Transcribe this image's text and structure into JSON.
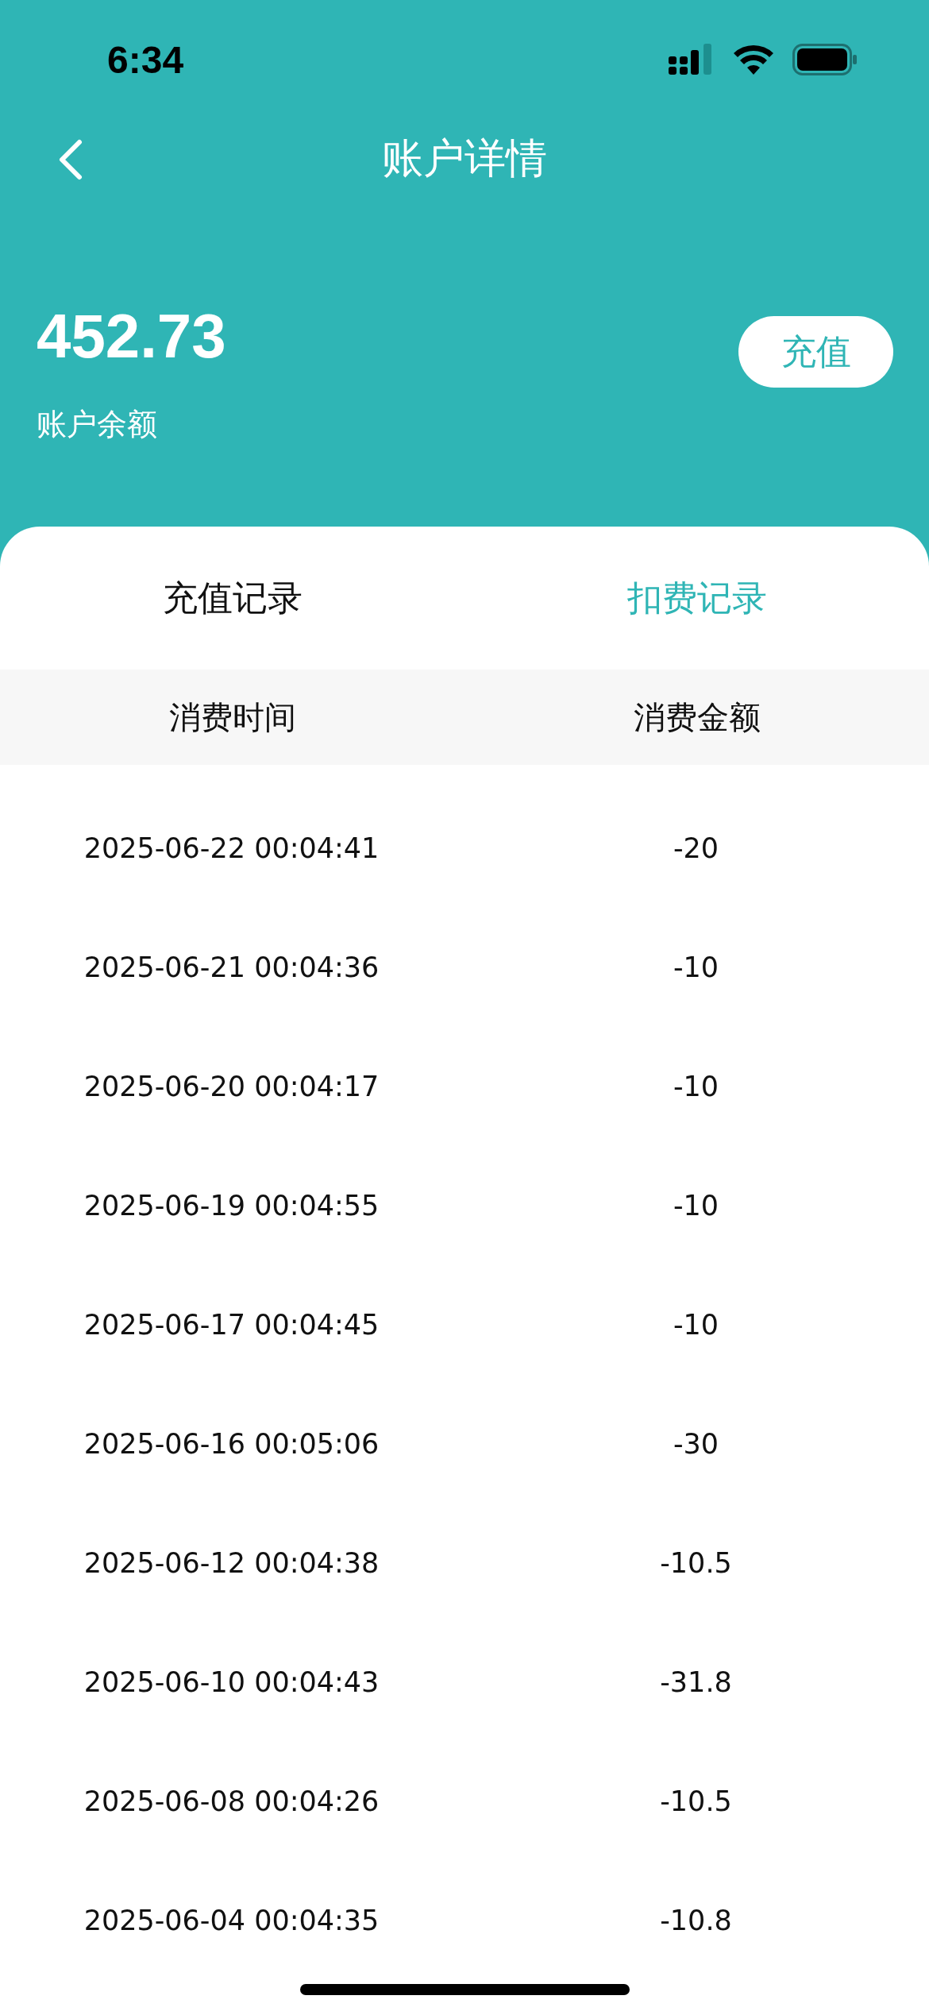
{
  "status_bar": {
    "time": "6:34"
  },
  "nav": {
    "title": "账户详情"
  },
  "balance": {
    "amount": "452.73",
    "label": "账户余额",
    "button": "充值"
  },
  "tabs": [
    {
      "label": "充值记录",
      "selected": false
    },
    {
      "label": "扣费记录",
      "selected": true
    }
  ],
  "table": {
    "columns": [
      "消费时间",
      "消费金额"
    ],
    "rows": [
      [
        "2025-06-22 00:04:41",
        "-20"
      ],
      [
        "2025-06-21 00:04:36",
        "-10"
      ],
      [
        "2025-06-20 00:04:17",
        "-10"
      ],
      [
        "2025-06-19 00:04:55",
        "-10"
      ],
      [
        "2025-06-17 00:04:45",
        "-10"
      ],
      [
        "2025-06-16 00:05:06",
        "-30"
      ],
      [
        "2025-06-12 00:04:38",
        "-10.5"
      ],
      [
        "2025-06-10 00:04:43",
        "-31.8"
      ],
      [
        "2025-06-08 00:04:26",
        "-10.5"
      ],
      [
        "2025-06-04 00:04:35",
        "-10.8"
      ]
    ]
  }
}
